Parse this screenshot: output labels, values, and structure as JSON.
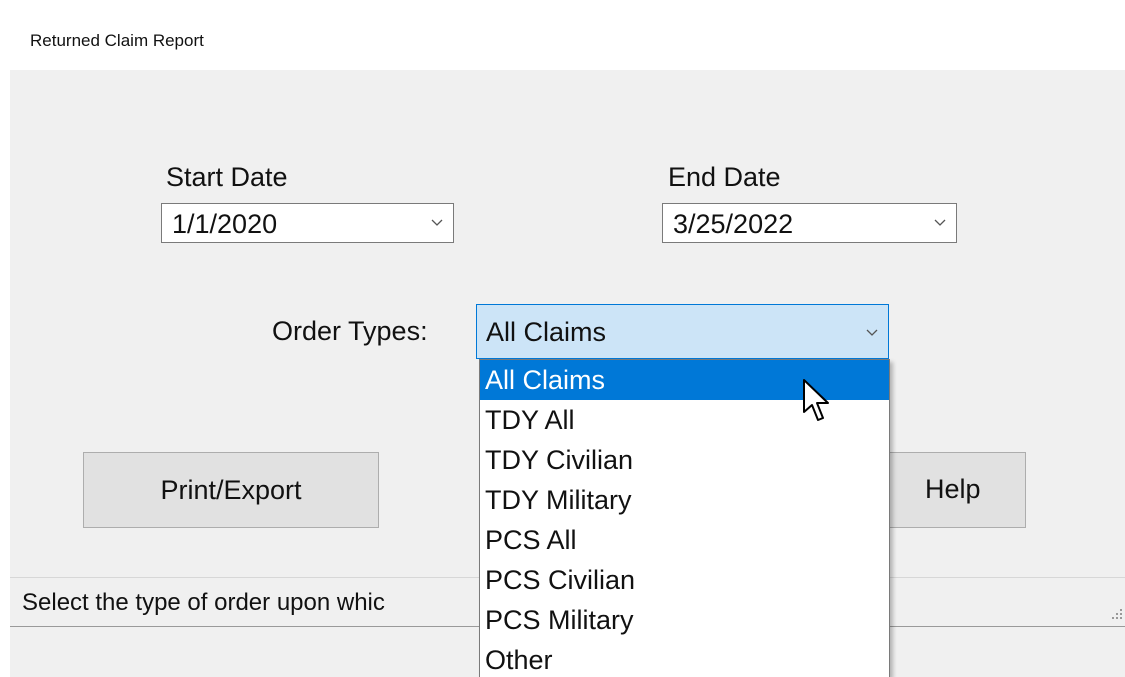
{
  "window": {
    "title": "Returned Claim Report"
  },
  "start_date": {
    "label": "Start Date",
    "value": "1/1/2020"
  },
  "end_date": {
    "label": "End Date",
    "value": "3/25/2022"
  },
  "order_types": {
    "label": "Order Types:",
    "value": "All Claims",
    "options": [
      "All Claims",
      "TDY All",
      "TDY Civilian",
      "TDY Military",
      "PCS All",
      "PCS Civilian",
      "PCS Military",
      "Other"
    ],
    "highlighted": "All Claims"
  },
  "buttons": {
    "print_export": "Print/Export",
    "help": "Help"
  },
  "status": {
    "text": "Select the type of order upon whic"
  },
  "icons": {
    "chevron": "chevron-down-icon",
    "help": "help-icon",
    "cursor": "mouse-cursor-icon",
    "grip": "resize-grip-icon"
  },
  "colors": {
    "selection": "#0078d7",
    "combo_bg": "#cce4f7",
    "panel": "#f0f0f0"
  }
}
